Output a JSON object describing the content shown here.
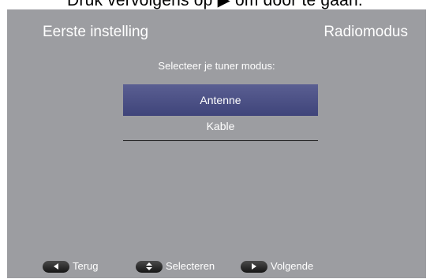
{
  "caption": "Druk vervolgens op ▶ om door te gaan.",
  "screen": {
    "header_left": "Eerste instelling",
    "header_right": "Radiomodus",
    "prompt": "Selecteer je tuner modus:",
    "options": [
      {
        "label": "Antenne",
        "selected": true
      },
      {
        "label": "Kable",
        "selected": false
      }
    ],
    "footer": {
      "back_label": "Terug",
      "select_label": "Selecteren",
      "next_label": "Volgende"
    }
  },
  "colors": {
    "screen_bg": "#9c9da1",
    "selection": "#4a4f85",
    "text": "#ffffff"
  }
}
